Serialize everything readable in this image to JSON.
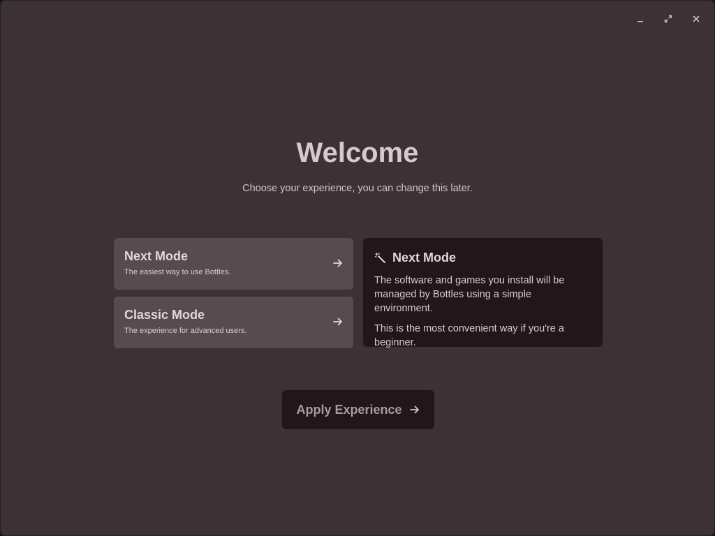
{
  "window": {
    "controls": [
      "minimize-icon",
      "maximize-icon",
      "close-icon"
    ]
  },
  "welcome": {
    "title": "Welcome",
    "subtitle": "Choose your experience, you can change this later."
  },
  "modes": [
    {
      "title": "Next Mode",
      "description": "The easiest way to use Bottles.",
      "icon": "arrow-right-icon"
    },
    {
      "title": "Classic Mode",
      "description": "The experience for advanced users.",
      "icon": "arrow-right-icon"
    }
  ],
  "info": {
    "icon": "magic-wand-icon",
    "title": "Next Mode",
    "paragraph1": "The software and games you install will be managed by Bottles using a simple environment.",
    "paragraph2": "This is the most convenient way if you're a beginner."
  },
  "apply": {
    "label": "Apply Experience",
    "icon": "arrow-right-icon"
  },
  "colors": {
    "window_bg": "#3c3135",
    "card_bg": "#564c50",
    "dark_card_bg": "#211619",
    "text": "#d9ccd0"
  }
}
